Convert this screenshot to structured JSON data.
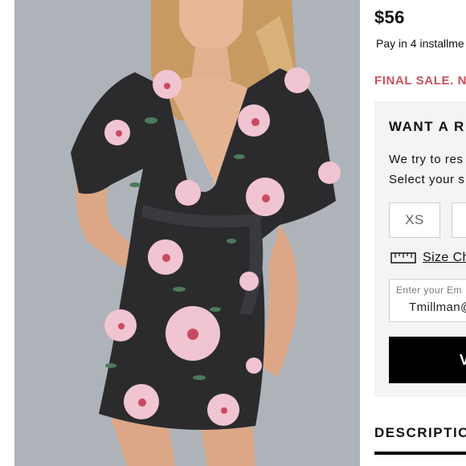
{
  "product_image": {
    "alt": ""
  },
  "price": "$56",
  "payment": {
    "text": "Pay in 4 installme"
  },
  "final_sale": "FINAL SALE. N",
  "restock_panel": {
    "title": "WANT A R",
    "line1": "We try to res",
    "line2": "Select your s",
    "sizes": [
      "XS",
      ""
    ],
    "size_chart_label": "Size Ch",
    "email_placeholder": "Enter your Em",
    "email_value": "Tmillman@",
    "notify_label": "V"
  },
  "tabs": {
    "description": "DESCRIPTIO"
  },
  "colors": {
    "final_sale": "#c9535c",
    "panel_bg": "#f4f4f4",
    "button_bg": "#000000",
    "photo_bg": "#aeb2b8"
  },
  "icons": {
    "size_chart": "ruler-icon"
  }
}
